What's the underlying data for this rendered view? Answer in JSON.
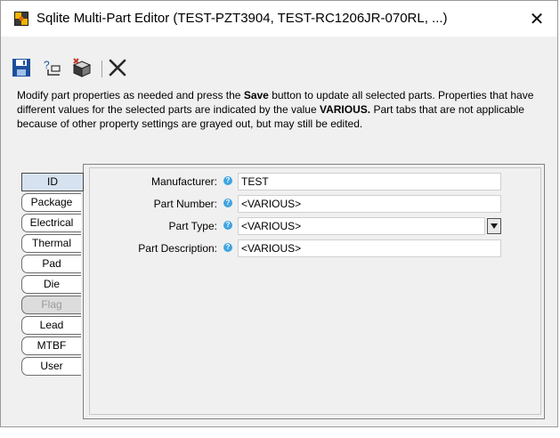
{
  "window": {
    "title": "Sqlite Multi-Part Editor (TEST-PZT3904, TEST-RC1206JR-070RL, ...)",
    "close_glyph": "✕"
  },
  "toolbar": {
    "icons": [
      "save-icon",
      "rename-icon",
      "parts-icon",
      "cancel-icon"
    ]
  },
  "description": {
    "part1": "Modify part properties as needed and press the ",
    "bold1": "Save",
    "part2": " button to update all selected parts. Properties that have different values for the selected parts are indicated by the value ",
    "bold2": "VARIOUS.",
    "part3": " Part tabs that are not applicable because of other property settings are grayed out, but may still be edited."
  },
  "tabs": [
    {
      "label": "ID",
      "state": "active"
    },
    {
      "label": "Package",
      "state": "normal"
    },
    {
      "label": "Electrical",
      "state": "normal"
    },
    {
      "label": "Thermal",
      "state": "normal"
    },
    {
      "label": "Pad",
      "state": "normal"
    },
    {
      "label": "Die",
      "state": "normal"
    },
    {
      "label": "Flag",
      "state": "disabled"
    },
    {
      "label": "Lead",
      "state": "normal"
    },
    {
      "label": "MTBF",
      "state": "normal"
    },
    {
      "label": "User",
      "state": "normal"
    }
  ],
  "fields": {
    "manufacturer": {
      "label": "Manufacturer:",
      "value": "TEST"
    },
    "part_number": {
      "label": "Part Number:",
      "value": "<VARIOUS>"
    },
    "part_type": {
      "label": "Part Type:",
      "value": "<VARIOUS>"
    },
    "part_description": {
      "label": "Part Description:",
      "value": "<VARIOUS>"
    }
  },
  "help_glyph": "?",
  "colors": {
    "help_icon": "#3fa4e0",
    "active_tab": "#d6e2ef",
    "disabled_tab": "#dcdcdc",
    "save_icon": "#1f4f9b"
  }
}
